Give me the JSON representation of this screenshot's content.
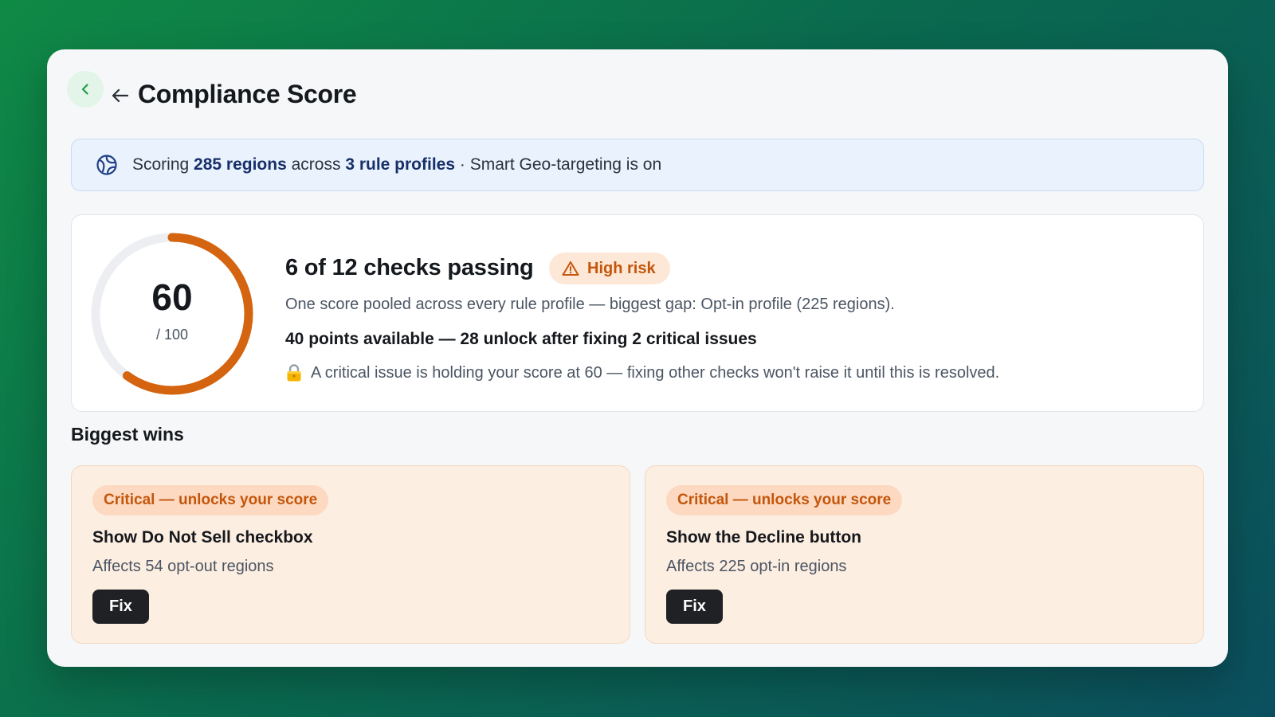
{
  "header": {
    "title": "Compliance Score",
    "back_icon": "chevron-left-icon",
    "back_arrow_icon": "arrow-left-icon"
  },
  "banner": {
    "icon": "globe-icon",
    "prefix": "Scoring ",
    "regions": "285 regions",
    "middle": " across ",
    "profiles": "3 rule profiles",
    "suffix": " · Smart Geo-targeting is on"
  },
  "score": {
    "value": "60",
    "max": "/ 100",
    "progress": 0.6,
    "checks_title": "6 of 12 checks passing",
    "risk_label": "High risk",
    "risk_icon": "warning-icon",
    "description": "One score pooled across every rule profile — biggest gap: Opt-in profile (225 regions).",
    "points": "40 points available — 28 unlock after fixing 2 critical issues",
    "lock_icon": "lock-icon",
    "lock_message": "A critical issue is holding your score at 60 — fixing other checks won't raise it until this is resolved."
  },
  "wins": {
    "title": "Biggest wins",
    "items": [
      {
        "badge": "Critical — unlocks your score",
        "title": "Show Do Not Sell checkbox",
        "subtitle": "Affects 54 opt-out regions",
        "button": "Fix"
      },
      {
        "badge": "Critical — unlocks your score",
        "title": "Show the Decline button",
        "subtitle": "Affects 225 opt-in regions",
        "button": "Fix"
      }
    ]
  },
  "colors": {
    "accent": "#d4640f",
    "brand_green": "#1f9d4c",
    "banner_strong": "#17306a",
    "badge_bg": "#fde7d6"
  }
}
